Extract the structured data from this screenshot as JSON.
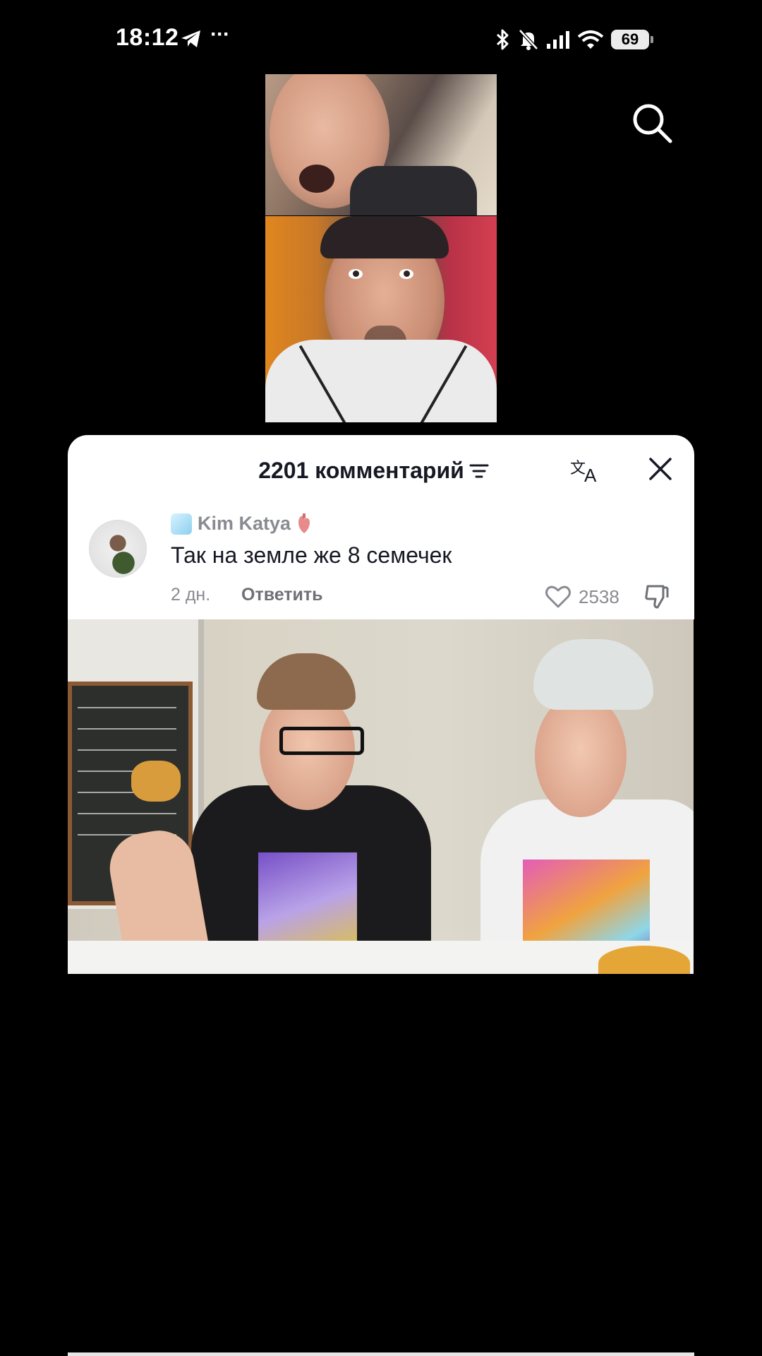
{
  "status_bar": {
    "time": "18:12",
    "more": "···",
    "battery": "69"
  },
  "comments": {
    "title": "2201 комментарий",
    "items": [
      {
        "username": "Kim Katya",
        "text": "Так на земле же 8 семечек",
        "age": "2 дн.",
        "reply_label": "Ответить",
        "likes": "2538"
      }
    ]
  },
  "colors": {
    "background": "#000000",
    "sheet": "#ffffff",
    "primary_text": "#161823",
    "secondary_text": "#8a8b91"
  },
  "icons": [
    "telegram-icon",
    "bluetooth-icon",
    "bell-off-icon",
    "signal-icon",
    "wifi-icon",
    "battery-icon",
    "search-icon",
    "sort-icon",
    "translate-icon",
    "close-icon",
    "heart-icon",
    "dislike-icon"
  ]
}
